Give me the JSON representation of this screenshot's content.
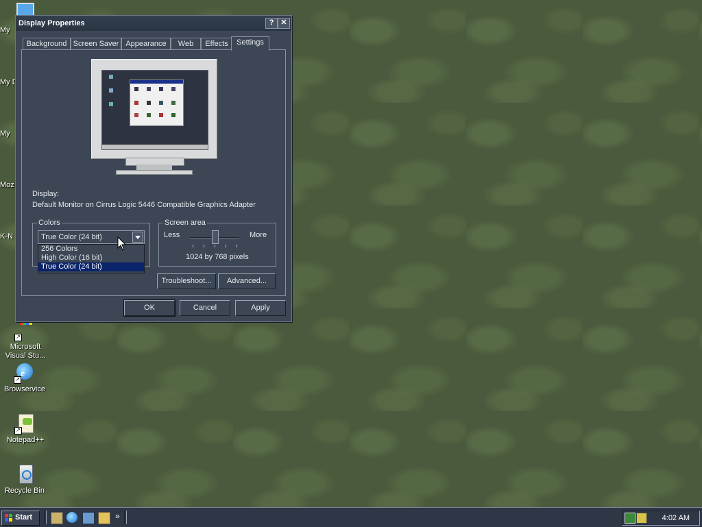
{
  "desktop": {
    "edge_labels": [
      "My",
      "My D",
      "My",
      "Moz",
      "K-N"
    ],
    "icons": [
      {
        "label": "Microsoft Visual Stu...",
        "icon": "visual-studio-icon"
      },
      {
        "label": "Browservice",
        "icon": "internet-explorer-icon"
      },
      {
        "label": "Notepad++",
        "icon": "notepad-plus-plus-icon"
      },
      {
        "label": "Recycle Bin",
        "icon": "recycle-bin-icon"
      }
    ]
  },
  "dialog": {
    "title": "Display Properties",
    "help_button": "?",
    "close_button": "✕",
    "tabs": [
      {
        "label": "Background"
      },
      {
        "label": "Screen Saver"
      },
      {
        "label": "Appearance"
      },
      {
        "label": "Web"
      },
      {
        "label": "Effects"
      },
      {
        "label": "Settings",
        "active": true
      }
    ],
    "display_label": "Display:",
    "display_value": "Default Monitor on Cirrus Logic 5446 Compatible Graphics Adapter",
    "colors": {
      "legend": "Colors",
      "selected": "True Color (24 bit)",
      "options": [
        "256 Colors",
        "High Color (16 bit)",
        "True Color (24 bit)"
      ],
      "highlighted_index": 2
    },
    "screen_area": {
      "legend": "Screen area",
      "less": "Less",
      "more": "More",
      "value": "1024 by 768 pixels",
      "slider_level": 0.5
    },
    "troubleshoot_label": "Troubleshoot...",
    "advanced_label": "Advanced...",
    "ok_label": "OK",
    "cancel_label": "Cancel",
    "apply_label": "Apply"
  },
  "taskbar": {
    "start_label": "Start",
    "chevron": "»",
    "clock": "4:02 AM"
  },
  "colors": {
    "dialog_bg": "#3c4655",
    "selection": "#0a246a",
    "desktop": "#4a5a3c"
  }
}
